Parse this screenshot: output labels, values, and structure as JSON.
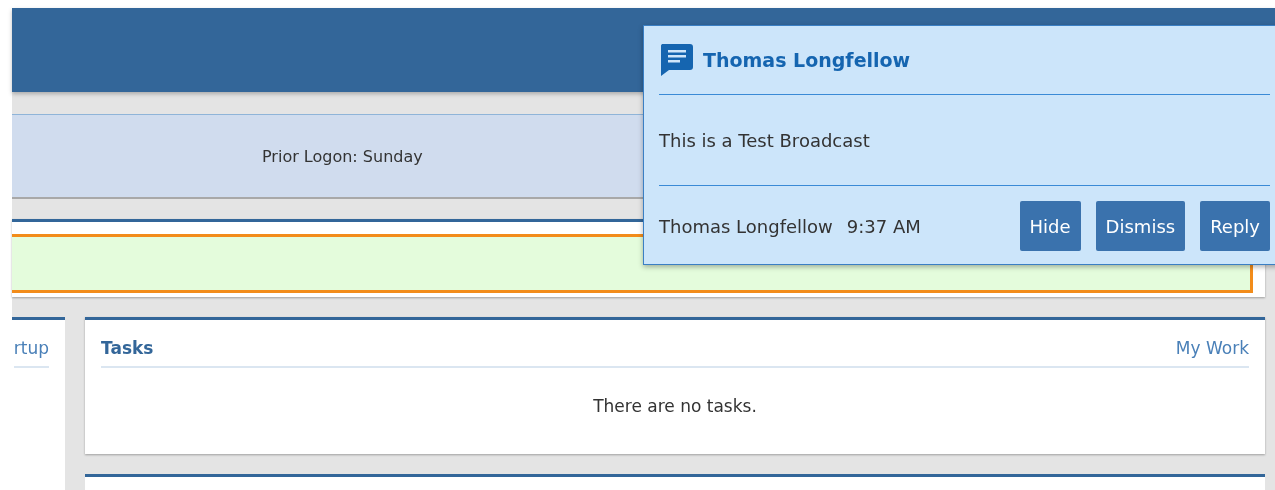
{
  "prior_logon": {
    "text": "Prior Logon: Sunday"
  },
  "left_card": {
    "title": "rtup"
  },
  "tasks": {
    "title": "Tasks",
    "link": "My Work",
    "empty_text": "There are no tasks."
  },
  "broadcast": {
    "sender": "Thomas Longfellow",
    "message": "This is a Test Broadcast",
    "footer_sender": "Thomas Longfellow",
    "time": "9:37 AM",
    "buttons": [
      "Hide",
      "Dismiss",
      "Reply"
    ]
  }
}
